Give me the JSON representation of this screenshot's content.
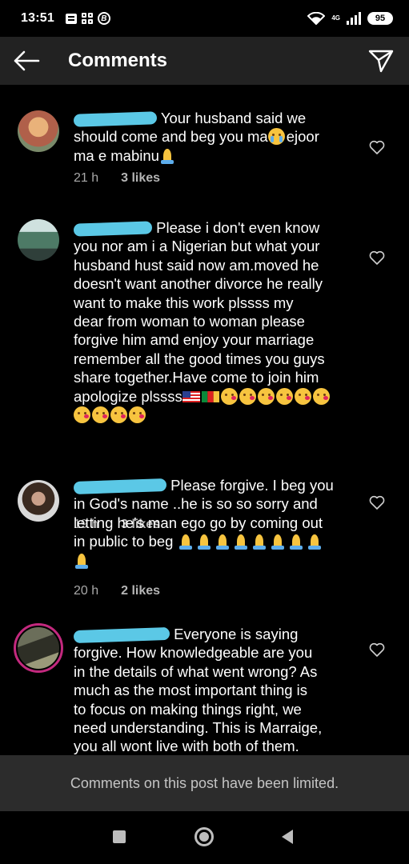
{
  "status_bar": {
    "time": "13:51",
    "network": "4G",
    "battery": "95",
    "icons": [
      "message-icon",
      "grid-icon",
      "b-icon",
      "wifi-icon",
      "signal-icon",
      "battery-icon"
    ]
  },
  "header": {
    "title": "Comments",
    "back_icon": "back-arrow-icon",
    "send_icon": "send-icon"
  },
  "comments": [
    {
      "text_parts": [
        "Your husband said we",
        "should come and beg you ma",
        "ejoor",
        "ma e mabinu"
      ],
      "time": "21 h",
      "likes": "3 likes",
      "colors": {
        "avatar_bg": "#a07a5a"
      }
    },
    {
      "text_parts": [
        "Please i don't even know",
        "you nor am i a Nigerian but what your",
        "husband hust said now am.moved he",
        "doesn't want another divorce he really",
        "want to make this work plssss my",
        "dear from woman to woman please",
        "forgive him amd enjoy your marriage",
        "remember all the good times you guys",
        "share together.Have come to join him",
        "apologize plssss"
      ],
      "time": "19 h",
      "likes": "3 likes"
    },
    {
      "text_parts": [
        "Please forgive. I beg you",
        "in God's name ..he is so so sorry and",
        "letting he's man ego go by coming out",
        "in public to beg"
      ],
      "time": "20 h",
      "likes": "2 likes"
    },
    {
      "text_parts": [
        "Everyone is saying",
        "forgive. How knowledgeable are you",
        "in the details of what went wrong? As",
        "much as the most important thing is",
        "to focus on making things right, we",
        "need understanding. This is Marraige,",
        "you all wont live with both of them."
      ]
    }
  ],
  "limited_banner": "Comments on this post have been limited.",
  "nav": {
    "recent_icon": "recent-apps-icon",
    "home_icon": "home-icon",
    "back_icon": "nav-back-icon"
  },
  "colors": {
    "background": "#000000",
    "header": "#222222",
    "redaction": "#5bc8e6",
    "story_ring": "#c3297e"
  }
}
